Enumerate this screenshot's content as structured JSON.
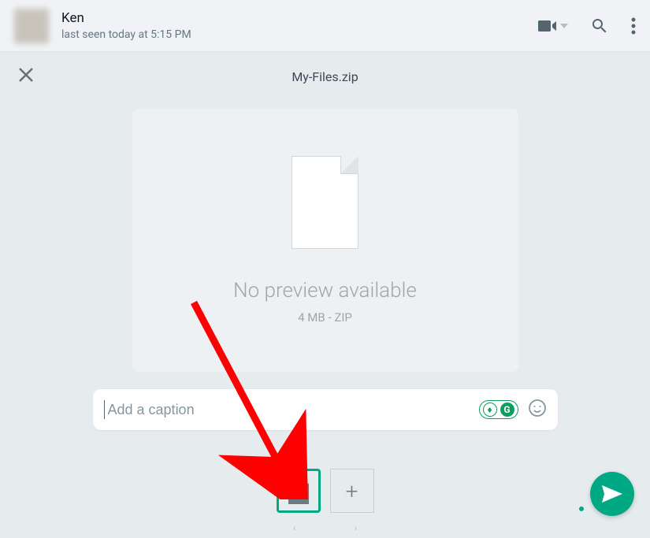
{
  "header": {
    "contact_name": "Ken",
    "last_seen": "last seen today at 5:15 PM"
  },
  "attachment": {
    "file_name": "My-Files.zip",
    "no_preview_text": "No preview available",
    "file_size": "4 MB",
    "file_type": "ZIP"
  },
  "caption": {
    "placeholder": "Add a caption",
    "value": ""
  },
  "colors": {
    "accent": "#00a884",
    "arrow": "#fe0000"
  }
}
